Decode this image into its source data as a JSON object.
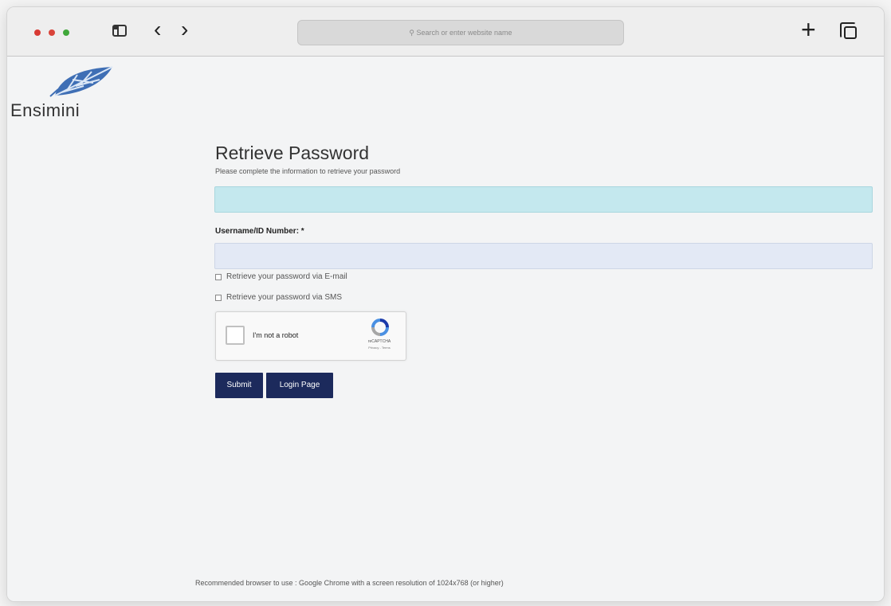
{
  "browser": {
    "url_placeholder": "Search or enter website name"
  },
  "brand": {
    "name": "Ensimini",
    "logo_color": "#3f6fb5"
  },
  "form": {
    "title": "Retrieve Password",
    "subtitle": "Please complete the information to retrieve your password",
    "username_label": "Username/ID Number: *",
    "username_value": "",
    "option_email_label": "Retrieve your password via E-mail",
    "option_sms_label": "Retrieve your password via SMS",
    "submit_label": "Submit",
    "login_page_label": "Login Page"
  },
  "captcha": {
    "label": "I'm not a robot",
    "brand": "reCAPTCHA",
    "links": "Privacy - Terms"
  },
  "footer": {
    "text": "Recommended browser to use : Google Chrome with a screen resolution of 1024x768 (or higher)"
  },
  "colors": {
    "button_bg": "#1c2a5c",
    "info_bg": "#c4e8ee",
    "input_bg": "#e3e9f5"
  }
}
